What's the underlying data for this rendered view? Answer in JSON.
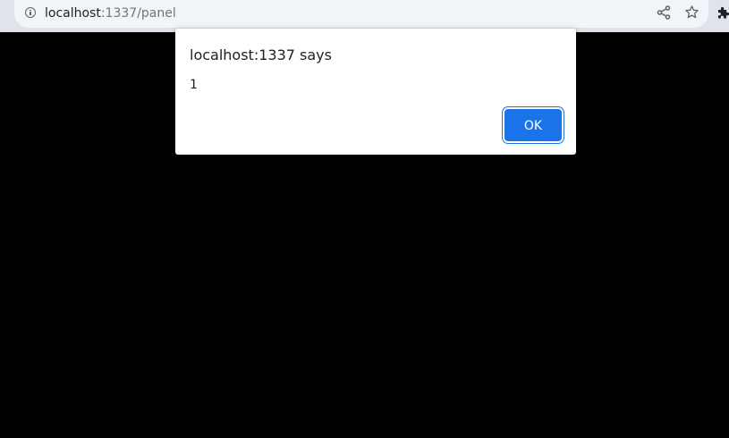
{
  "browser": {
    "url_host": "localhost",
    "url_path": ":1337/panel",
    "icons": {
      "site_info": "info-icon",
      "share": "share-icon",
      "bookmark": "star-icon",
      "extensions": "puzzle-piece-icon"
    }
  },
  "dialog": {
    "title": "localhost:1337 says",
    "message": "1",
    "ok_label": "OK"
  },
  "colors": {
    "page_background": "#000000",
    "toolbar": "#dfe3ea",
    "omnibox": "#f1f4f9",
    "accent_button": "#1a73e8",
    "dialog_background": "#ffffff"
  }
}
